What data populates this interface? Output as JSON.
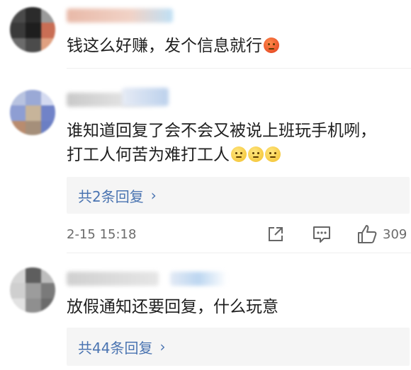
{
  "comments": [
    {
      "text_lines": [
        "钱这么好赚，发个信息就行"
      ],
      "emojis": [
        "angry-face"
      ]
    },
    {
      "text_lines": [
        "谁知道回复了会不会又被说上班玩手机咧，",
        "打工人何苦为难打工人"
      ],
      "emojis": [
        "sweat-smile",
        "sweat-smile",
        "sweat-smile"
      ],
      "replies_label": "共2条回复",
      "timestamp": "2-15 15:18",
      "like_count": "309"
    },
    {
      "text_lines": [
        "放假通知还要回复，什么玩意"
      ],
      "replies_label": "共44条回复"
    }
  ],
  "colors": {
    "link": "#4a74b1",
    "reply_bg": "#f5f5f5"
  },
  "icons": [
    "share-icon",
    "comment-icon",
    "like-icon",
    "chevron-right-icon"
  ]
}
